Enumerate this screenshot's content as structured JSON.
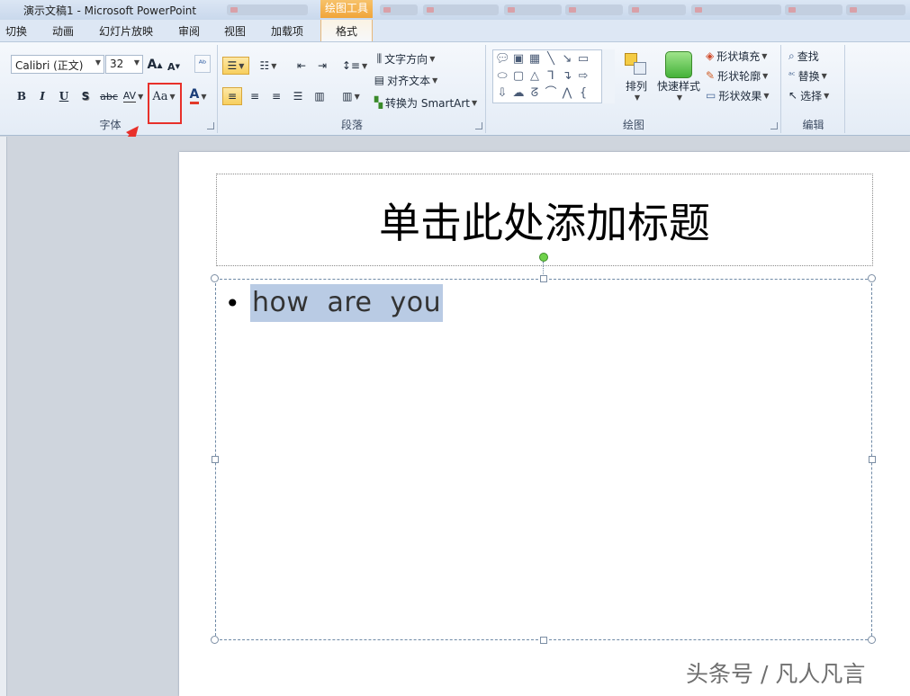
{
  "window": {
    "title": "演示文稿1 - Microsoft PowerPoint",
    "context_tab_header": "绘图工具"
  },
  "tabs": [
    {
      "label": "切换"
    },
    {
      "label": "动画"
    },
    {
      "label": "幻灯片放映"
    },
    {
      "label": "审阅"
    },
    {
      "label": "视图"
    },
    {
      "label": "加载项"
    },
    {
      "label": "格式",
      "active": true
    }
  ],
  "font_group": {
    "label": "字体",
    "font_name": "Calibri (正文)",
    "font_size": "32",
    "grow": "A",
    "shrink": "A",
    "bold": "B",
    "italic": "I",
    "underline": "U",
    "shadow": "S",
    "strike": "abc",
    "spacing": "AV",
    "change_case": "Aa",
    "font_color": "A",
    "font_color_value": "#e23a2a"
  },
  "paragraph_group": {
    "label": "段落",
    "text_direction": "文字方向",
    "align_text": "对齐文本",
    "convert_smartart": "转换为 SmartArt"
  },
  "drawing_group": {
    "label": "绘图",
    "arrange": "排列",
    "quick_styles": "快速样式",
    "shape_fill": "形状填充",
    "shape_outline": "形状轮廓",
    "shape_effects": "形状效果"
  },
  "editing_group": {
    "label": "编辑",
    "find": "查找",
    "replace": "替换",
    "select": "选择"
  },
  "slide": {
    "title_placeholder": "单击此处添加标题",
    "bullet_char": "•",
    "body_text": "how are you"
  },
  "watermark": "头条号 / 凡人凡言",
  "colors": {
    "highlight_box": "#e8302a",
    "text_selection": "#b9cbe4",
    "context_tab": "#f0a53a"
  }
}
